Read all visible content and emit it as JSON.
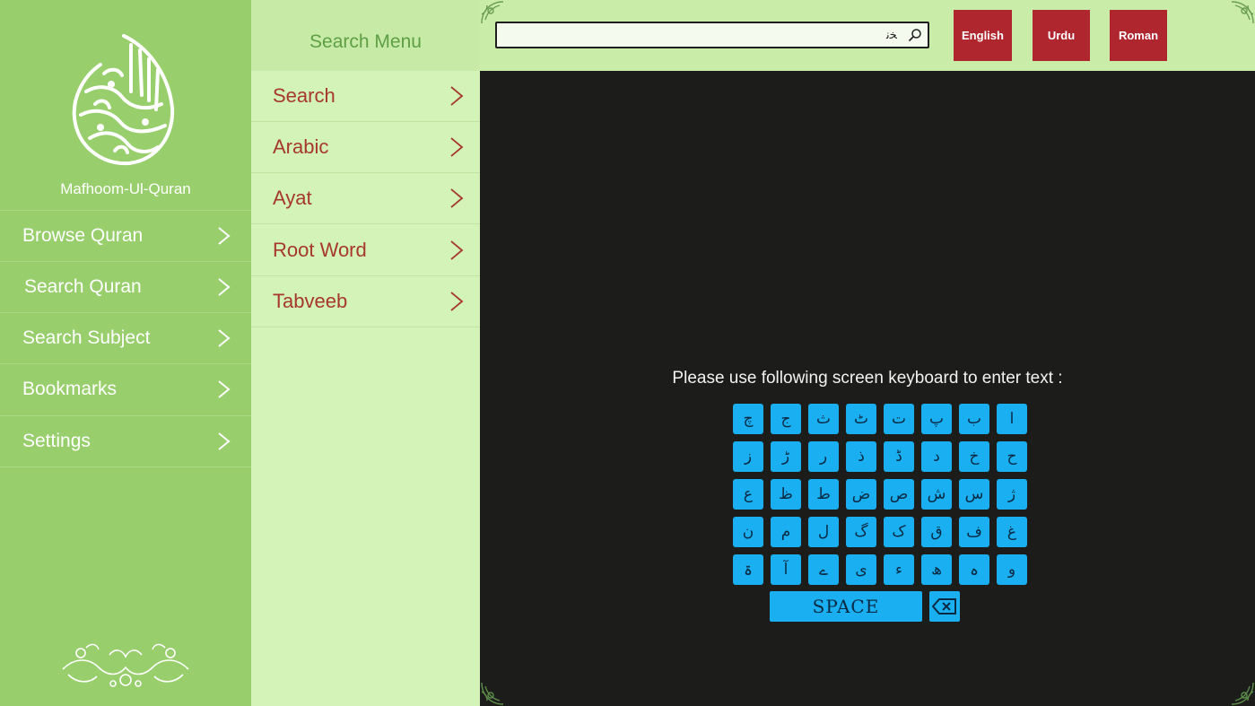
{
  "app": {
    "name": "Mafhoom-Ul-Quran"
  },
  "nav": {
    "items": [
      {
        "label": "Browse Quran"
      },
      {
        "label": "Search Quran"
      },
      {
        "label": "Search Subject"
      },
      {
        "label": "Bookmarks"
      },
      {
        "label": "Settings"
      }
    ]
  },
  "search_menu": {
    "title": "Search Menu",
    "items": [
      {
        "label": "Search"
      },
      {
        "label": "Arabic"
      },
      {
        "label": "Ayat"
      },
      {
        "label": "Root Word"
      },
      {
        "label": "Tabveeb"
      }
    ]
  },
  "search": {
    "value": "ﺨﻧ",
    "icon": "search-icon"
  },
  "languages": {
    "english": "English",
    "urdu": "Urdu",
    "roman": "Roman",
    "color": "#b0262f"
  },
  "keyboard": {
    "instruction": "Please use following screen keyboard to enter text :",
    "rows": [
      [
        "ا",
        "ب",
        "پ",
        "ت",
        "ٹ",
        "ث",
        "ج",
        "چ"
      ],
      [
        "ح",
        "خ",
        "د",
        "ڈ",
        "ذ",
        "ر",
        "ڑ",
        "ز"
      ],
      [
        "ژ",
        "س",
        "ش",
        "ص",
        "ض",
        "ط",
        "ظ",
        "ع"
      ],
      [
        "غ",
        "ف",
        "ق",
        "ک",
        "گ",
        "ل",
        "م",
        "ن"
      ],
      [
        "و",
        "ہ",
        "ھ",
        "ء",
        "ی",
        "ے",
        "آ",
        "ۃ"
      ]
    ],
    "space_label": "SPACE",
    "backspace_icon": "backspace-icon",
    "key_color": "#1aaff0"
  },
  "colors": {
    "nav_bg": "#98cf6c",
    "menu_bg": "#d3f3b8",
    "menu_text": "#a6382e",
    "content_bg": "#1c1d1a"
  }
}
